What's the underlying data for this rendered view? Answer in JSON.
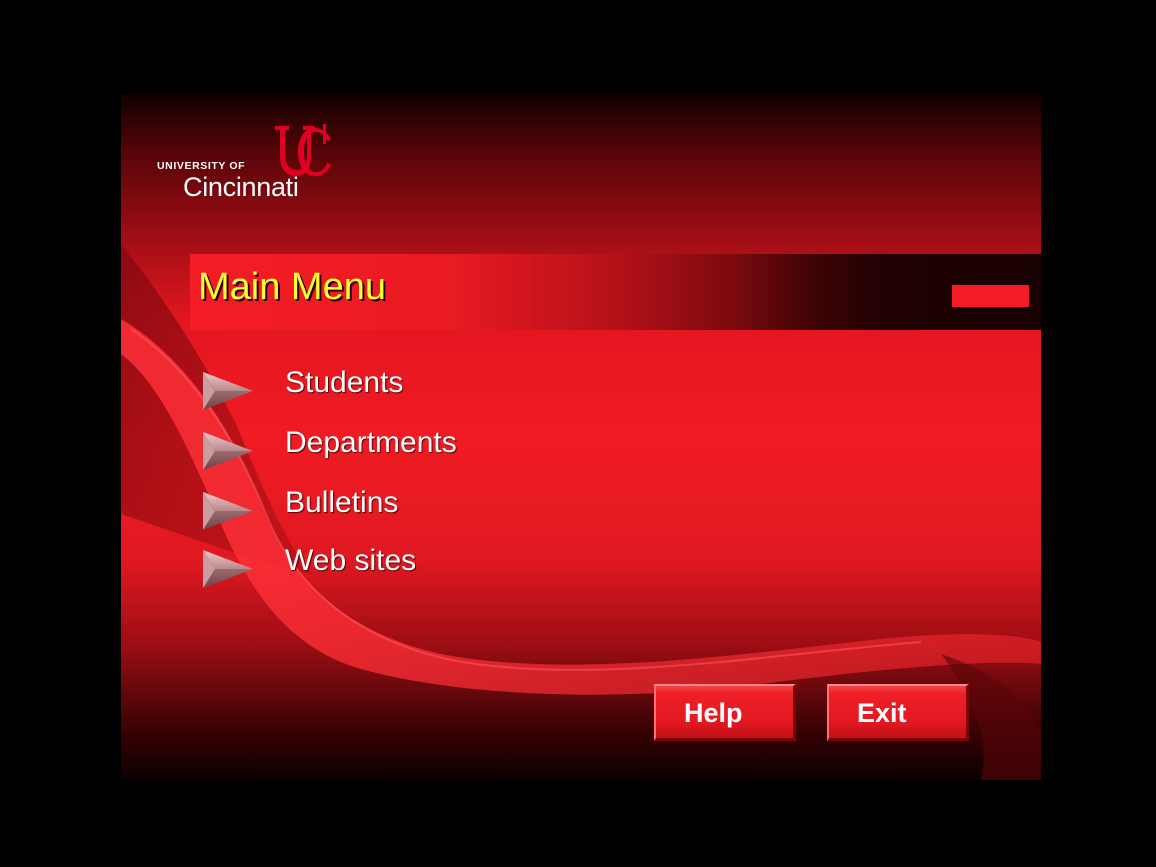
{
  "logo": {
    "line1": "UNIVERSITY OF",
    "line2": "Cincinnati",
    "mark_letters": "UC",
    "color": "#e00122"
  },
  "title": "Main Menu",
  "menu": {
    "items": [
      {
        "label": "Students",
        "icon": "arrow-right-icon"
      },
      {
        "label": "Departments",
        "icon": "arrow-right-icon"
      },
      {
        "label": "Bulletins",
        "icon": "arrow-right-icon"
      },
      {
        "label": "Web sites",
        "icon": "arrow-right-icon"
      }
    ]
  },
  "buttons": {
    "help": "Help",
    "exit": "Exit"
  },
  "colors": {
    "background": "#f01b23",
    "title_text": "#ffff33",
    "menu_text": "#ffffff",
    "frame": "#000000"
  }
}
